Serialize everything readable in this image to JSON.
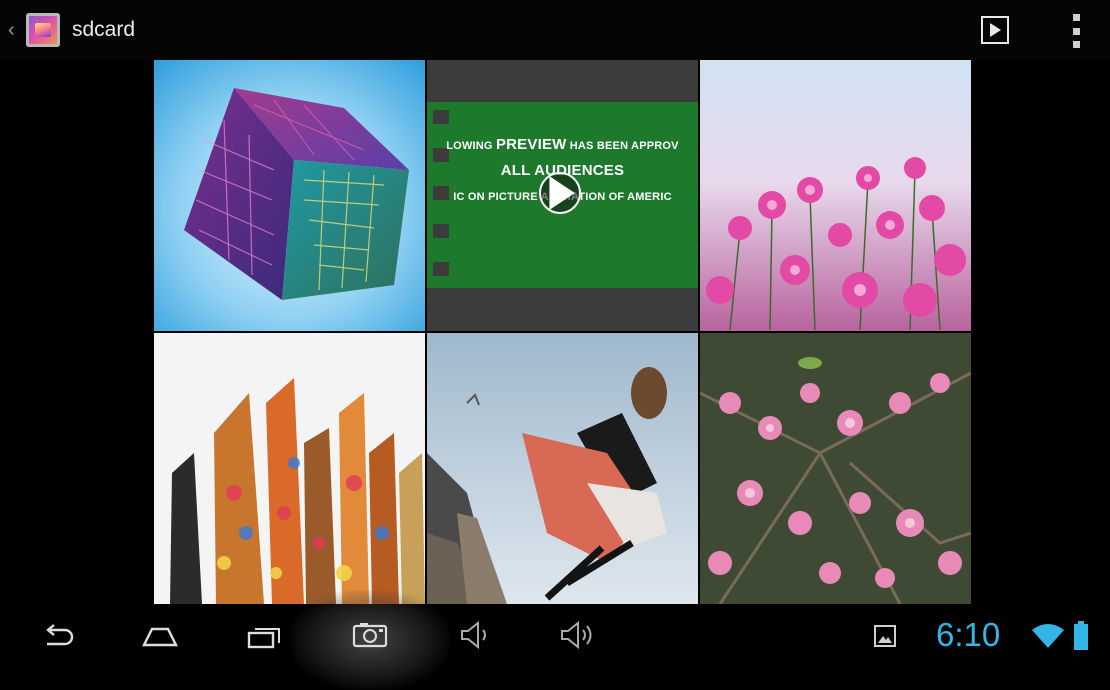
{
  "actionbar": {
    "title": "sdcard",
    "up_icon": "chevron-left-icon",
    "app_icon": "gallery-app-icon",
    "slideshow_icon": "slideshow-play-icon",
    "overflow_icon": "overflow-menu-icon"
  },
  "gallery": {
    "tiles": [
      {
        "kind": "image",
        "subject": "circuit cube"
      },
      {
        "kind": "video",
        "lines": [
          "LOWING PREVIEW HAS BEEN APPROV",
          "ALL AUDIENCES",
          "IC  ON PICTURE AS CIATION OF AMERIC"
        ],
        "line1_bold": "PREVIEW",
        "play_icon": "play-icon"
      },
      {
        "kind": "image",
        "subject": "pink cosmos flowers"
      },
      {
        "kind": "image",
        "subject": "paint brushes"
      },
      {
        "kind": "image",
        "subject": "jumping woman"
      },
      {
        "kind": "image",
        "subject": "plum blossoms"
      }
    ]
  },
  "navbar": {
    "back_icon": "back-icon",
    "home_icon": "home-icon",
    "recents_icon": "recent-apps-icon",
    "screenshot_icon": "screenshot-icon",
    "volume_down_icon": "volume-down-icon",
    "volume_up_icon": "volume-up-icon",
    "gallery_notification_icon": "gallery-notification-icon",
    "clock": "6:10",
    "wifi_icon": "wifi-icon",
    "battery_icon": "battery-icon",
    "accent_color": "#33b5e5"
  }
}
